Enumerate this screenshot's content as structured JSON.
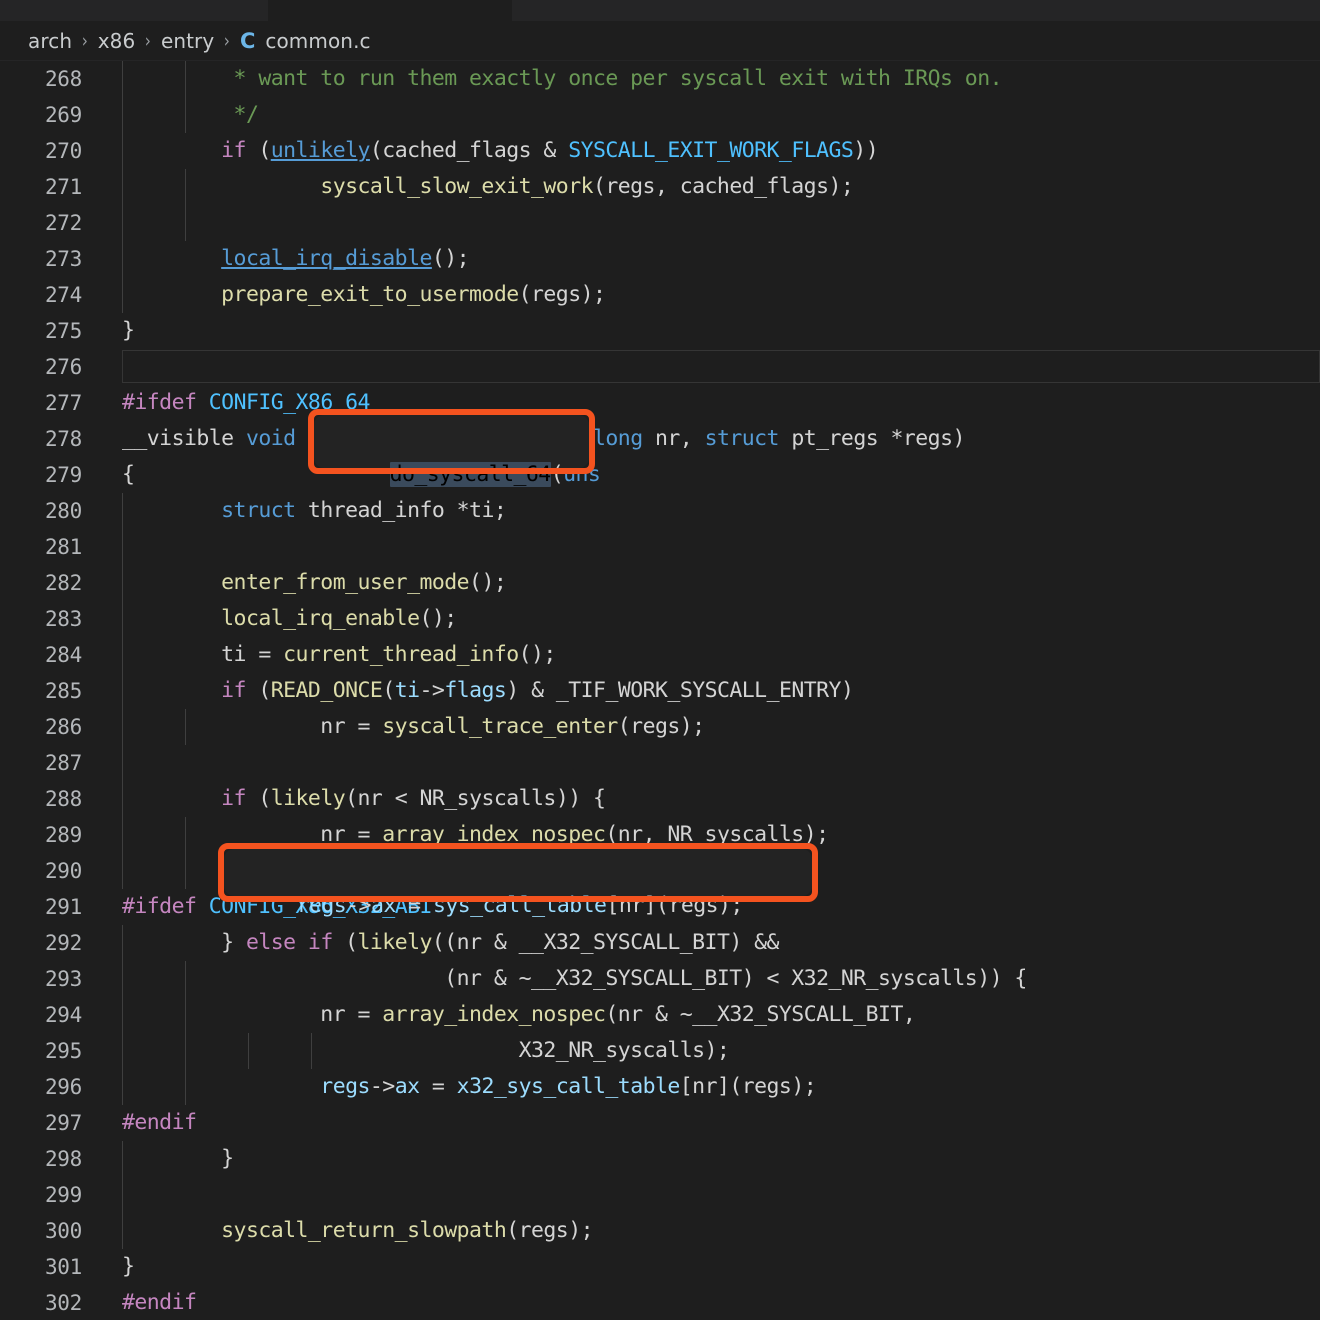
{
  "window": {
    "background": "#1e1e1e",
    "accent_annotation_color": "#f4531f"
  },
  "tabs": [
    {
      "name": "tab-inactive-left",
      "active": false
    },
    {
      "name": "tab-active-common-c",
      "active": true
    },
    {
      "name": "tab-inactive-right",
      "active": false
    }
  ],
  "breadcrumb": {
    "items": [
      "arch",
      "x86",
      "entry"
    ],
    "separator": "›",
    "file_icon": "C",
    "file_name": "common.c"
  },
  "editor": {
    "language": "c",
    "first_visible_line": 268,
    "current_line": 276,
    "selection_text": "do_syscall_64",
    "lines": [
      {
        "n": 268,
        "text": "         * want to run them exactly once per syscall exit with IRQs on."
      },
      {
        "n": 269,
        "text": "         */"
      },
      {
        "n": 270,
        "text": "        if (unlikely(cached_flags & SYSCALL_EXIT_WORK_FLAGS))"
      },
      {
        "n": 271,
        "text": "                syscall_slow_exit_work(regs, cached_flags);"
      },
      {
        "n": 272,
        "text": ""
      },
      {
        "n": 273,
        "text": "        local_irq_disable();"
      },
      {
        "n": 274,
        "text": "        prepare_exit_to_usermode(regs);"
      },
      {
        "n": 275,
        "text": "}"
      },
      {
        "n": 276,
        "text": ""
      },
      {
        "n": 277,
        "text": "#ifdef CONFIG_X86_64"
      },
      {
        "n": 278,
        "text": "__visible void do_syscall_64(unsigned long nr, struct pt_regs *regs)"
      },
      {
        "n": 279,
        "text": "{"
      },
      {
        "n": 280,
        "text": "        struct thread_info *ti;"
      },
      {
        "n": 281,
        "text": ""
      },
      {
        "n": 282,
        "text": "        enter_from_user_mode();"
      },
      {
        "n": 283,
        "text": "        local_irq_enable();"
      },
      {
        "n": 284,
        "text": "        ti = current_thread_info();"
      },
      {
        "n": 285,
        "text": "        if (READ_ONCE(ti->flags) & _TIF_WORK_SYSCALL_ENTRY)"
      },
      {
        "n": 286,
        "text": "                nr = syscall_trace_enter(regs);"
      },
      {
        "n": 287,
        "text": ""
      },
      {
        "n": 288,
        "text": "        if (likely(nr < NR_syscalls)) {"
      },
      {
        "n": 289,
        "text": "                nr = array_index_nospec(nr, NR_syscalls);"
      },
      {
        "n": 290,
        "text": "                regs->ax = sys_call_table[nr](regs);"
      },
      {
        "n": 291,
        "text": "#ifdef CONFIG_X86_X32_ABI"
      },
      {
        "n": 292,
        "text": "        } else if (likely((nr & __X32_SYSCALL_BIT) &&"
      },
      {
        "n": 293,
        "text": "                          (nr & ~__X32_SYSCALL_BIT) < X32_NR_syscalls)) {"
      },
      {
        "n": 294,
        "text": "                nr = array_index_nospec(nr & ~__X32_SYSCALL_BIT,"
      },
      {
        "n": 295,
        "text": "                                X32_NR_syscalls);"
      },
      {
        "n": 296,
        "text": "                regs->ax = x32_sys_call_table[nr](regs);"
      },
      {
        "n": 297,
        "text": "#endif"
      },
      {
        "n": 298,
        "text": "        }"
      },
      {
        "n": 299,
        "text": ""
      },
      {
        "n": 300,
        "text": "        syscall_return_slowpath(regs);"
      },
      {
        "n": 301,
        "text": "}"
      },
      {
        "n": 302,
        "text": "#endif"
      }
    ]
  },
  "annotations": [
    {
      "name": "highlight-do-syscall-64",
      "target_line": 278,
      "target_text": "do_syscall_64",
      "color": "#f4531f"
    },
    {
      "name": "highlight-sys-call-table-dispatch",
      "target_line": 290,
      "target_text": "regs->ax = sys_call_table[nr](regs);",
      "color": "#f4531f"
    }
  ]
}
